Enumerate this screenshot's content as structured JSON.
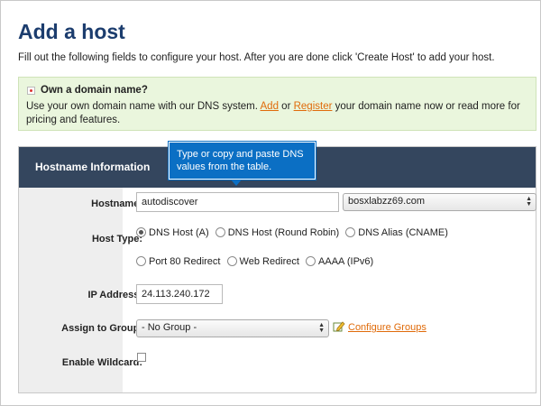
{
  "page": {
    "title": "Add a host",
    "intro": "Fill out the following fields to configure your host. After you are done click 'Create Host' to add your host."
  },
  "notice": {
    "icon": "info-icon",
    "title": "Own a domain name?",
    "text_before": "Use your own domain name with our DNS system.",
    "link_add": "Add",
    "text_or": "or",
    "link_register": "Register",
    "text_after": "your domain name now or read more for pricing and features.",
    "background": "#eaf6dd"
  },
  "panel": {
    "header": "Hostname Information",
    "header_color": "#34465e"
  },
  "tooltip": {
    "text": "Type or copy and paste DNS values from the table.",
    "color": "#0b6fc4"
  },
  "form": {
    "hostname": {
      "label": "Hostname:",
      "value": "autodiscover",
      "domain": "bosxlabzz69.com"
    },
    "host_type": {
      "label": "Host Type:",
      "options": [
        {
          "label": "DNS Host (A)",
          "checked": true
        },
        {
          "label": "DNS Host (Round Robin)",
          "checked": false
        },
        {
          "label": "DNS Alias (CNAME)",
          "checked": false
        },
        {
          "label": "Port 80 Redirect",
          "checked": false
        },
        {
          "label": "Web Redirect",
          "checked": false
        },
        {
          "label": "AAAA (IPv6)",
          "checked": false
        }
      ]
    },
    "ip_address": {
      "label": "IP Address:",
      "value": "24.113.240.172"
    },
    "group": {
      "label": "Assign to Group:",
      "value": "- No Group -",
      "link": "Configure Groups",
      "icon": "pencil-icon"
    },
    "wildcard": {
      "label": "Enable Wildcard:",
      "checked": false
    }
  },
  "link_color": "#e06b0a"
}
